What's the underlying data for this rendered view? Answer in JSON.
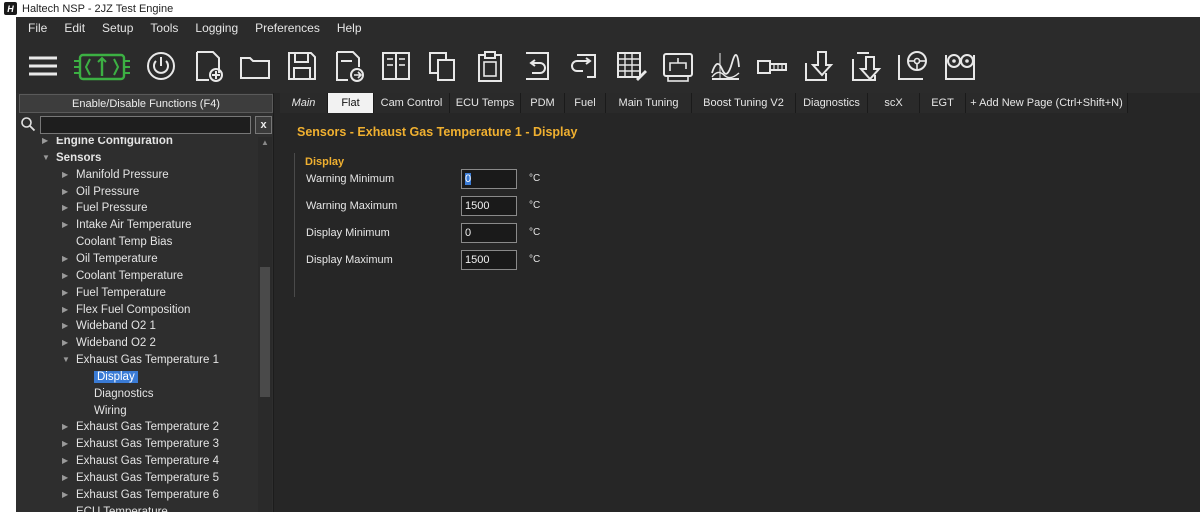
{
  "window": {
    "title": "Haltech NSP - 2JZ Test Engine",
    "logo_text": "H"
  },
  "menu": [
    "File",
    "Edit",
    "Setup",
    "Tools",
    "Logging",
    "Preferences",
    "Help"
  ],
  "toolbar_icons": [
    "hamburger-menu-icon",
    "ecu-connect-icon",
    "power-icon",
    "new-file-icon",
    "open-folder-icon",
    "save-icon",
    "export-file-icon",
    "compare-icon",
    "copy-icon",
    "clipboard-icon",
    "undo-icon",
    "redo-icon",
    "table-edit-icon",
    "tuning-map-icon",
    "chart-graph-icon",
    "sensor-icon",
    "download-icon",
    "upload-icon",
    "steering-wheel-icon",
    "controller-icon"
  ],
  "sidebar": {
    "enable_button": "Enable/Disable Functions (F4)",
    "search_value": "",
    "clear_label": "x",
    "tree": [
      {
        "label": "Engine Configuration",
        "level": 0,
        "bold": true,
        "arrow": "▶"
      },
      {
        "label": "Sensors",
        "level": 0,
        "bold": true,
        "arrow": "▼"
      },
      {
        "label": "Manifold Pressure",
        "level": 1,
        "arrow": "▶"
      },
      {
        "label": "Oil Pressure",
        "level": 1,
        "arrow": "▶"
      },
      {
        "label": "Fuel Pressure",
        "level": 1,
        "arrow": "▶"
      },
      {
        "label": "Intake Air Temperature",
        "level": 1,
        "arrow": "▶"
      },
      {
        "label": "Coolant Temp Bias",
        "level": 1,
        "arrow": ""
      },
      {
        "label": "Oil Temperature",
        "level": 1,
        "arrow": "▶"
      },
      {
        "label": "Coolant Temperature",
        "level": 1,
        "arrow": "▶"
      },
      {
        "label": "Fuel Temperature",
        "level": 1,
        "arrow": "▶"
      },
      {
        "label": "Flex Fuel Composition",
        "level": 1,
        "arrow": "▶"
      },
      {
        "label": "Wideband O2 1",
        "level": 1,
        "arrow": "▶"
      },
      {
        "label": "Wideband O2 2",
        "level": 1,
        "arrow": "▶"
      },
      {
        "label": "Exhaust Gas Temperature 1",
        "level": 1,
        "arrow": "▼"
      },
      {
        "label": "Display",
        "level": 2,
        "arrow": "",
        "selected": true
      },
      {
        "label": "Diagnostics",
        "level": 2,
        "arrow": ""
      },
      {
        "label": "Wiring",
        "level": 2,
        "arrow": ""
      },
      {
        "label": "Exhaust Gas Temperature 2",
        "level": 1,
        "arrow": "▶"
      },
      {
        "label": "Exhaust Gas Temperature 3",
        "level": 1,
        "arrow": "▶"
      },
      {
        "label": "Exhaust Gas Temperature 4",
        "level": 1,
        "arrow": "▶"
      },
      {
        "label": "Exhaust Gas Temperature 5",
        "level": 1,
        "arrow": "▶"
      },
      {
        "label": "Exhaust Gas Temperature 6",
        "level": 1,
        "arrow": "▶"
      },
      {
        "label": "ECU Temperature",
        "level": 1,
        "arrow": ""
      }
    ]
  },
  "tabs": [
    {
      "label": "Main",
      "italic": true
    },
    {
      "label": "Flat",
      "active": true
    },
    {
      "label": "Cam Control"
    },
    {
      "label": "ECU Temps"
    },
    {
      "label": "PDM"
    },
    {
      "label": "Fuel"
    },
    {
      "label": "Main Tuning"
    },
    {
      "label": "Boost Tuning V2"
    },
    {
      "label": "Diagnostics"
    },
    {
      "label": "scX"
    },
    {
      "label": "EGT"
    },
    {
      "label": "+ Add New Page (Ctrl+Shift+N)"
    }
  ],
  "content": {
    "title": "Sensors - Exhaust Gas Temperature 1 - Display",
    "group_title": "Display",
    "fields": [
      {
        "label": "Warning Minimum",
        "value": "0",
        "unit": "°C"
      },
      {
        "label": "Warning Maximum",
        "value": "1500",
        "unit": "°C"
      },
      {
        "label": "Display Minimum",
        "value": "0",
        "unit": "°C"
      },
      {
        "label": "Display Maximum",
        "value": "1500",
        "unit": "°C"
      }
    ]
  },
  "colors": {
    "accent": "#f0b030",
    "selection": "#3a7bd5",
    "connect_icon": "#3cb043"
  }
}
